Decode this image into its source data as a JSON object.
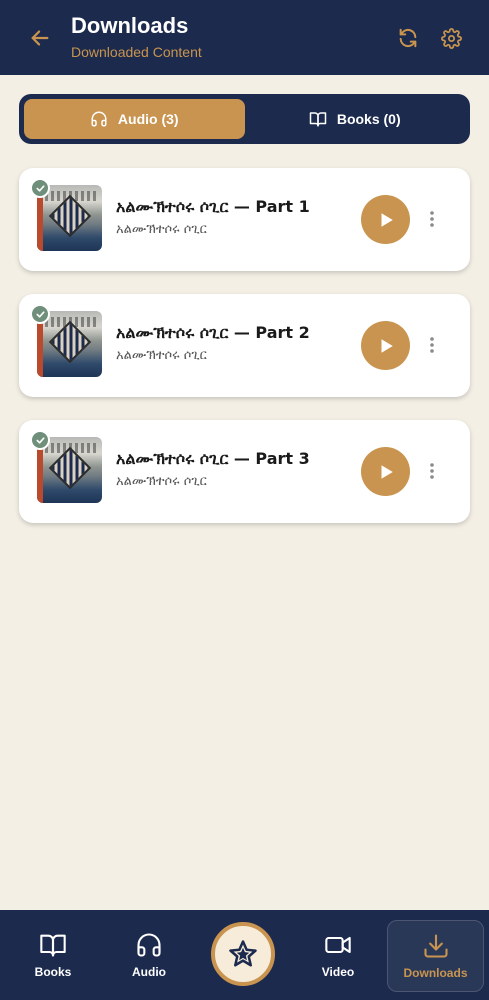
{
  "header": {
    "title": "Downloads",
    "subtitle": "Downloaded Content",
    "back_icon": "arrow-left-icon",
    "refresh_icon": "refresh-icon",
    "settings_icon": "gear-icon"
  },
  "tabs": [
    {
      "label": "Audio (3)",
      "icon": "headphones-icon",
      "active": true
    },
    {
      "label": "Books (0)",
      "icon": "book-icon",
      "active": false
    }
  ],
  "items": [
    {
      "title": "አልሙኽተሶሩ ሶጊር — Part 1",
      "subtitle": "አልሙኽተሶሩ ሶጊር",
      "downloaded": true
    },
    {
      "title": "አልሙኽተሶሩ ሶጊር — Part 2",
      "subtitle": "አልሙኽተሶሩ ሶጊር",
      "downloaded": true
    },
    {
      "title": "አልሙኽተሶሩ ሶጊር — Part 3",
      "subtitle": "አልሙኽተሶሩ ሶጊር",
      "downloaded": true
    }
  ],
  "bottom_nav": [
    {
      "label": "Books",
      "icon": "book-icon"
    },
    {
      "label": "Audio",
      "icon": "headphones-icon"
    },
    {
      "label": "",
      "icon": "star-icon"
    },
    {
      "label": "Video",
      "icon": "video-camera-icon"
    },
    {
      "label": "Downloads",
      "icon": "download-icon",
      "active": true
    }
  ],
  "colors": {
    "navy": "#1c2a4d",
    "gold": "#c9944f",
    "background": "#f3efe5",
    "check_green": "#6f8f7a"
  }
}
